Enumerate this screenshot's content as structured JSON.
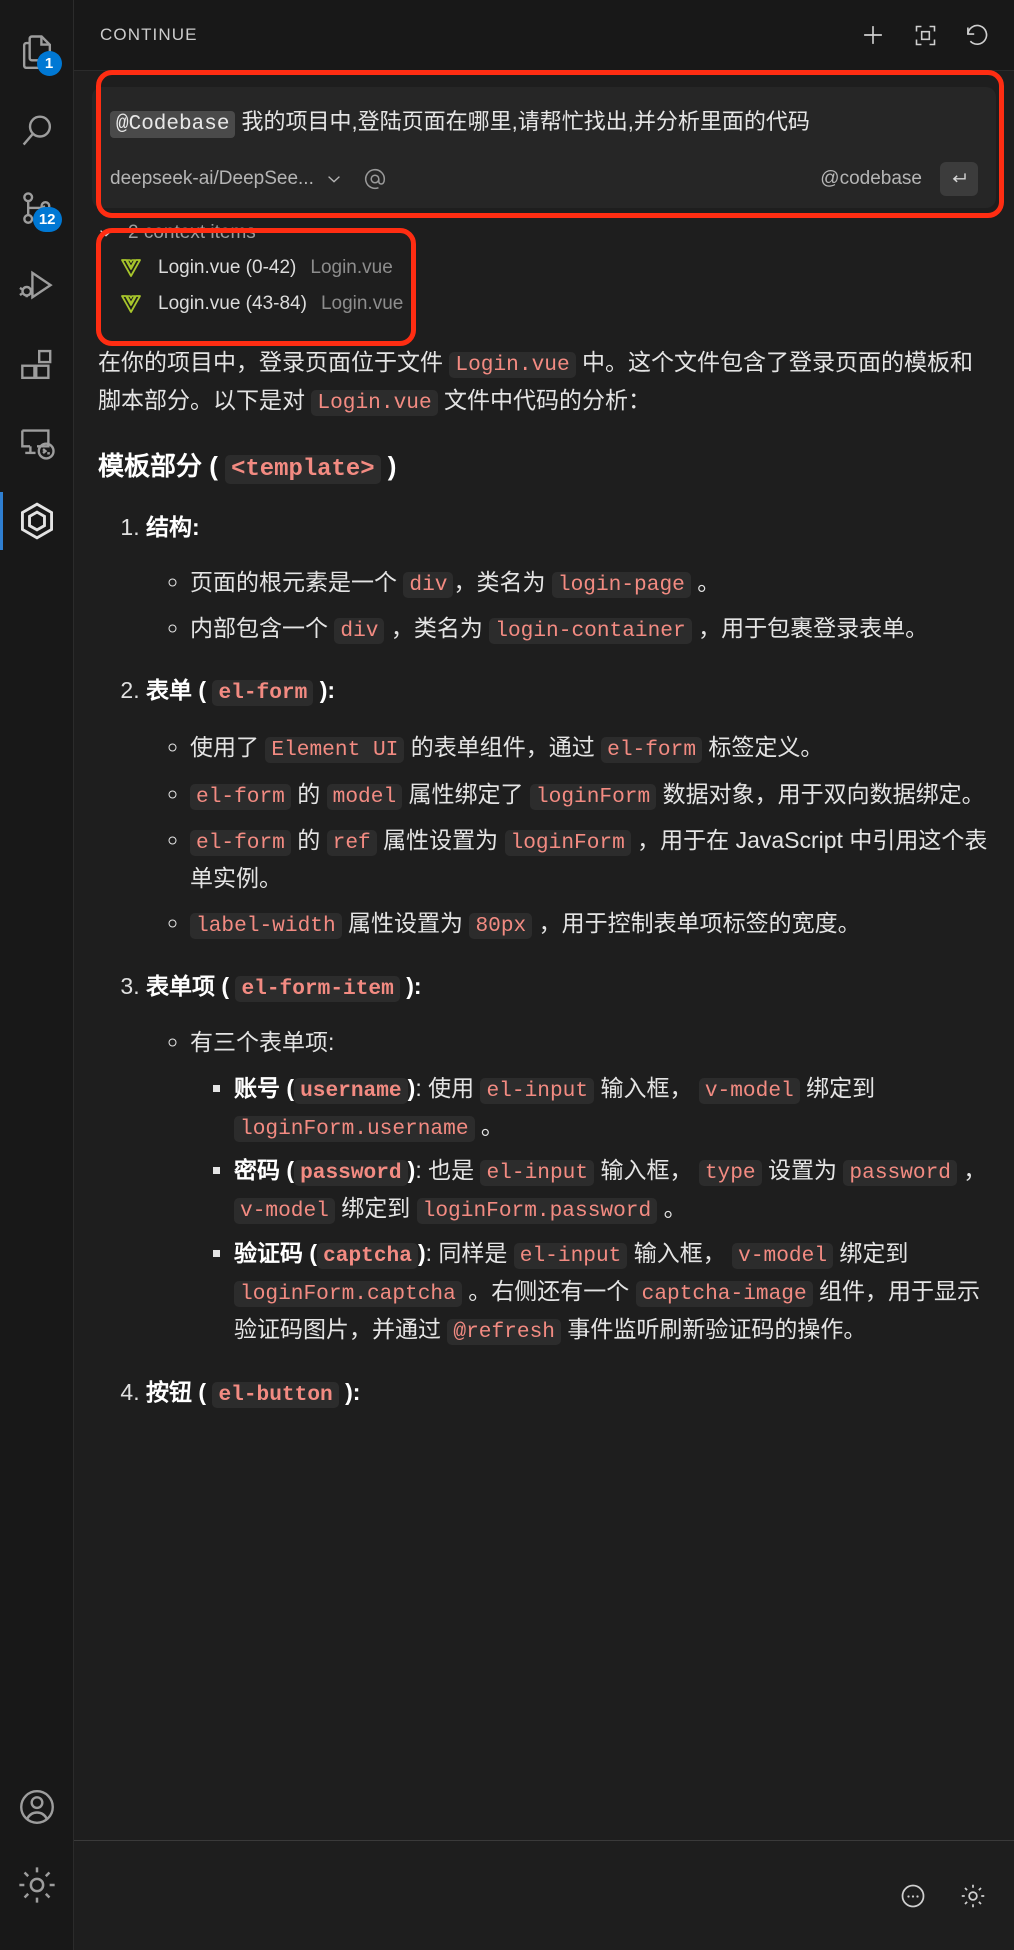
{
  "activity_bar": {
    "items": [
      {
        "name": "explorer",
        "icon": "files-icon",
        "badge": "1"
      },
      {
        "name": "search",
        "icon": "search-icon",
        "badge": null
      },
      {
        "name": "source-control",
        "icon": "source-control-icon",
        "badge": "12"
      },
      {
        "name": "run-and-debug",
        "icon": "run-debug-icon",
        "badge": null
      },
      {
        "name": "extensions",
        "icon": "extensions-icon",
        "badge": null
      },
      {
        "name": "remote-explorer",
        "icon": "remote-explorer-icon",
        "badge": null
      },
      {
        "name": "continue",
        "icon": "continue-icon",
        "badge": null
      }
    ],
    "bottom_items": [
      {
        "name": "accounts",
        "icon": "account-icon"
      },
      {
        "name": "manage",
        "icon": "gear-icon"
      }
    ]
  },
  "header": {
    "title": "CONTINUE",
    "actions": [
      {
        "name": "new-session",
        "icon": "plus-icon"
      },
      {
        "name": "expand-panel",
        "icon": "expand-icon"
      },
      {
        "name": "history",
        "icon": "history-icon"
      }
    ]
  },
  "composer": {
    "mention": "@Codebase",
    "text": "我的项目中,登陆页面在哪里,请帮忙找出,并分析里面的代码",
    "model": "deepseek-ai/DeepSee...",
    "at_icon": "at-icon",
    "chevron": "chevron-down-icon",
    "codebase_label": "@codebase",
    "enter_icon": "enter-return-icon"
  },
  "context": {
    "toggle_label": "2 context items",
    "chevron": "chevron-down-icon",
    "items": [
      {
        "icon": "vue-icon",
        "name": "Login.vue (0-42)",
        "sub": "Login.vue"
      },
      {
        "icon": "vue-icon",
        "name": "Login.vue (43-84)",
        "sub": "Login.vue"
      }
    ]
  },
  "answer": {
    "intro": [
      {
        "t": "text",
        "v": "在你的项目中，登录页面位于文件 "
      },
      {
        "t": "code",
        "v": "Login.vue"
      },
      {
        "t": "text",
        "v": " 中。这个文件包含了登录页面的模板和脚本部分。以下是对 "
      },
      {
        "t": "code",
        "v": "Login.vue"
      },
      {
        "t": "text",
        "v": " 文件中代码的分析："
      }
    ],
    "section_heading": [
      {
        "t": "text",
        "v": "模板部分 ( "
      },
      {
        "t": "code",
        "v": "<template>"
      },
      {
        "t": "text",
        "v": " )"
      }
    ],
    "items": [
      {
        "title": [
          {
            "t": "text",
            "v": "结构:"
          }
        ],
        "children": [
          {
            "parts": [
              {
                "t": "text",
                "v": "页面的根元素是一个 "
              },
              {
                "t": "code",
                "v": "div"
              },
              {
                "t": "text",
                "v": "，类名为 "
              },
              {
                "t": "code",
                "v": "login-page"
              },
              {
                "t": "text",
                "v": " 。"
              }
            ]
          },
          {
            "parts": [
              {
                "t": "text",
                "v": "内部包含一个 "
              },
              {
                "t": "code",
                "v": "div"
              },
              {
                "t": "text",
                "v": " ，类名为 "
              },
              {
                "t": "code",
                "v": "login-container"
              },
              {
                "t": "text",
                "v": " ，用于包裹登录表单。"
              }
            ]
          }
        ]
      },
      {
        "title": [
          {
            "t": "text",
            "v": "表单 ( "
          },
          {
            "t": "code",
            "v": "el-form"
          },
          {
            "t": "text",
            "v": " ):"
          }
        ],
        "children": [
          {
            "parts": [
              {
                "t": "text",
                "v": "使用了 "
              },
              {
                "t": "code",
                "v": "Element UI"
              },
              {
                "t": "text",
                "v": " 的表单组件，通过 "
              },
              {
                "t": "code",
                "v": "el-form"
              },
              {
                "t": "text",
                "v": " 标签定义。"
              }
            ]
          },
          {
            "parts": [
              {
                "t": "code",
                "v": "el-form"
              },
              {
                "t": "text",
                "v": " 的 "
              },
              {
                "t": "code",
                "v": "model"
              },
              {
                "t": "text",
                "v": " 属性绑定了 "
              },
              {
                "t": "code",
                "v": "loginForm"
              },
              {
                "t": "text",
                "v": " 数据对象，用于双向数据绑定。"
              }
            ]
          },
          {
            "parts": [
              {
                "t": "code",
                "v": "el-form"
              },
              {
                "t": "text",
                "v": " 的 "
              },
              {
                "t": "code",
                "v": "ref"
              },
              {
                "t": "text",
                "v": " 属性设置为 "
              },
              {
                "t": "code",
                "v": "loginForm"
              },
              {
                "t": "text",
                "v": " ，用于在 JavaScript 中引用这个表单实例。"
              }
            ]
          },
          {
            "parts": [
              {
                "t": "code",
                "v": "label-width"
              },
              {
                "t": "text",
                "v": " 属性设置为 "
              },
              {
                "t": "code",
                "v": "80px"
              },
              {
                "t": "text",
                "v": " ，用于控制表单项标签的宽度。"
              }
            ]
          }
        ]
      },
      {
        "title": [
          {
            "t": "text",
            "v": "表单项 ( "
          },
          {
            "t": "code",
            "v": "el-form-item"
          },
          {
            "t": "text",
            "v": " ):"
          }
        ],
        "children": [
          {
            "parts": [
              {
                "t": "text",
                "v": "有三个表单项:"
              }
            ],
            "sub": [
              {
                "parts": [
                  {
                    "t": "bold",
                    "v": "账号 ("
                  },
                  {
                    "t": "boldcode",
                    "v": "username"
                  },
                  {
                    "t": "bold",
                    "v": ")"
                  },
                  {
                    "t": "text",
                    "v": ": 使用 "
                  },
                  {
                    "t": "code",
                    "v": "el-input"
                  },
                  {
                    "t": "text",
                    "v": " 输入框， "
                  },
                  {
                    "t": "code",
                    "v": "v-model"
                  },
                  {
                    "t": "text",
                    "v": " 绑定到 "
                  },
                  {
                    "t": "code",
                    "v": "loginForm.username"
                  },
                  {
                    "t": "text",
                    "v": " 。"
                  }
                ]
              },
              {
                "parts": [
                  {
                    "t": "bold",
                    "v": "密码 ("
                  },
                  {
                    "t": "boldcode",
                    "v": "password"
                  },
                  {
                    "t": "bold",
                    "v": ")"
                  },
                  {
                    "t": "text",
                    "v": ": 也是 "
                  },
                  {
                    "t": "code",
                    "v": "el-input"
                  },
                  {
                    "t": "text",
                    "v": " 输入框， "
                  },
                  {
                    "t": "code",
                    "v": "type"
                  },
                  {
                    "t": "text",
                    "v": " 设置为 "
                  },
                  {
                    "t": "code",
                    "v": "password"
                  },
                  {
                    "t": "text",
                    "v": " ， "
                  },
                  {
                    "t": "code",
                    "v": "v-model"
                  },
                  {
                    "t": "text",
                    "v": " 绑定到 "
                  },
                  {
                    "t": "code",
                    "v": "loginForm.password"
                  },
                  {
                    "t": "text",
                    "v": " 。"
                  }
                ]
              },
              {
                "parts": [
                  {
                    "t": "bold",
                    "v": "验证码 ("
                  },
                  {
                    "t": "boldcode",
                    "v": "captcha"
                  },
                  {
                    "t": "bold",
                    "v": ")"
                  },
                  {
                    "t": "text",
                    "v": ": 同样是 "
                  },
                  {
                    "t": "code",
                    "v": "el-input"
                  },
                  {
                    "t": "text",
                    "v": " 输入框， "
                  },
                  {
                    "t": "code",
                    "v": "v-model"
                  },
                  {
                    "t": "text",
                    "v": " 绑定到 "
                  },
                  {
                    "t": "code",
                    "v": "loginForm.captcha"
                  },
                  {
                    "t": "text",
                    "v": " 。右侧还有一个 "
                  },
                  {
                    "t": "code",
                    "v": "captcha-image"
                  },
                  {
                    "t": "text",
                    "v": " 组件，用于显示验证码图片，并通过 "
                  },
                  {
                    "t": "code",
                    "v": "@refresh"
                  },
                  {
                    "t": "text",
                    "v": " 事件监听刷新验证码的操作。"
                  }
                ]
              }
            ]
          }
        ]
      },
      {
        "title": [
          {
            "t": "text",
            "v": "按钮 ( "
          },
          {
            "t": "code",
            "v": "el-button"
          },
          {
            "t": "text",
            "v": " ):"
          }
        ],
        "children": []
      }
    ]
  },
  "footer": {
    "actions": [
      {
        "name": "more-options",
        "icon": "ellipsis-circle-icon"
      },
      {
        "name": "settings",
        "icon": "gear-icon"
      }
    ]
  },
  "colors": {
    "background": "#1e1e1e",
    "activitybar_bg": "#181818",
    "accent_badge": "#0078d4",
    "annotation": "#ff2d12",
    "inline_code": "#f38b82",
    "vue_green": "#a7c52b"
  }
}
